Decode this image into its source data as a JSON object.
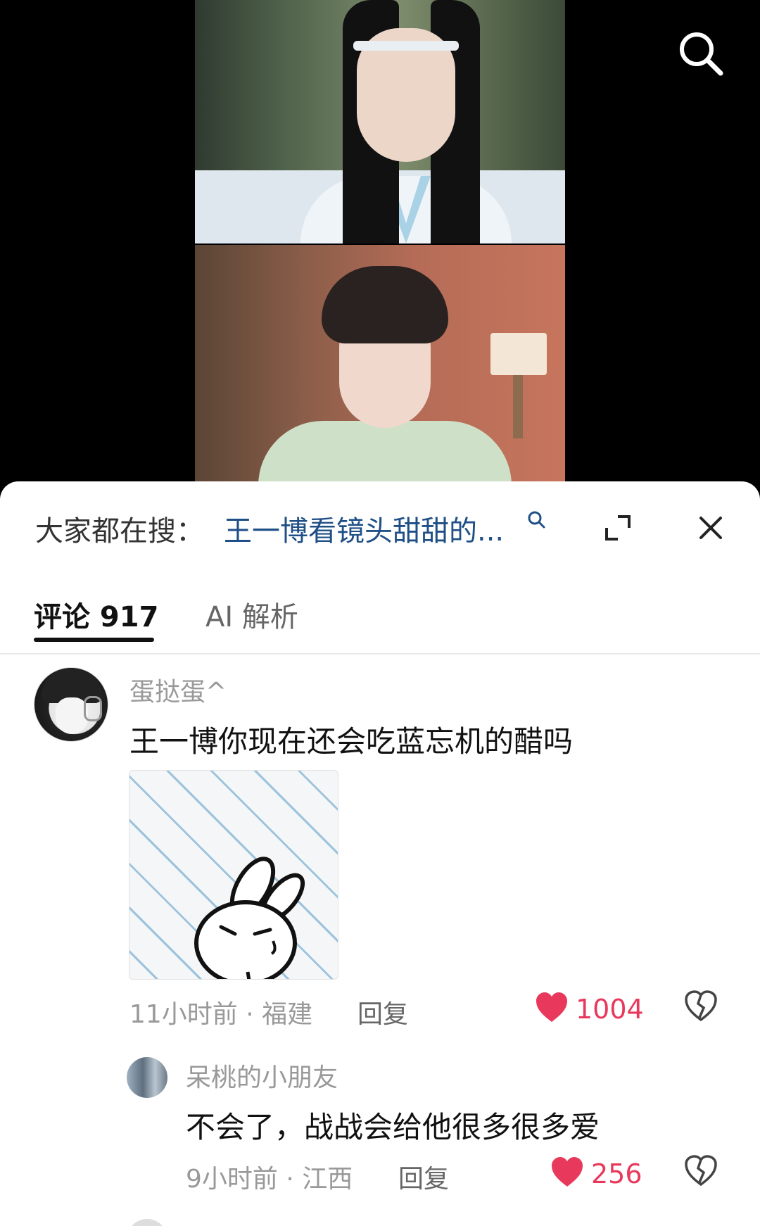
{
  "search_overlay": {
    "icon": "search-icon"
  },
  "sheet": {
    "search_bar": {
      "prefix": "大家都在搜：",
      "query": "王一博看镜头甜甜的...",
      "query_icon": "search-small-icon",
      "expand_icon": "expand-icon",
      "close_icon": "close-icon"
    },
    "tabs": [
      {
        "label": "评论 917",
        "active": true
      },
      {
        "label": "AI 解析",
        "active": false
      }
    ],
    "comments": [
      {
        "username": "蛋挞蛋^",
        "text": "王一博你现在还会吃蓝忘机的醋吗",
        "meta": "11小时前 · 福建",
        "reply_label": "回复",
        "likes": "1004",
        "liked": true,
        "replies": [
          {
            "username": "呆桃的小朋友",
            "text": "不会了，战战会给他很多很多爱",
            "meta": "9小时前 · 江西",
            "reply_label": "回复",
            "likes": "256",
            "liked": true
          }
        ]
      }
    ]
  },
  "colors": {
    "accent_like": "#e8395c",
    "query_link": "#1f4f86",
    "muted_text": "#999999"
  }
}
